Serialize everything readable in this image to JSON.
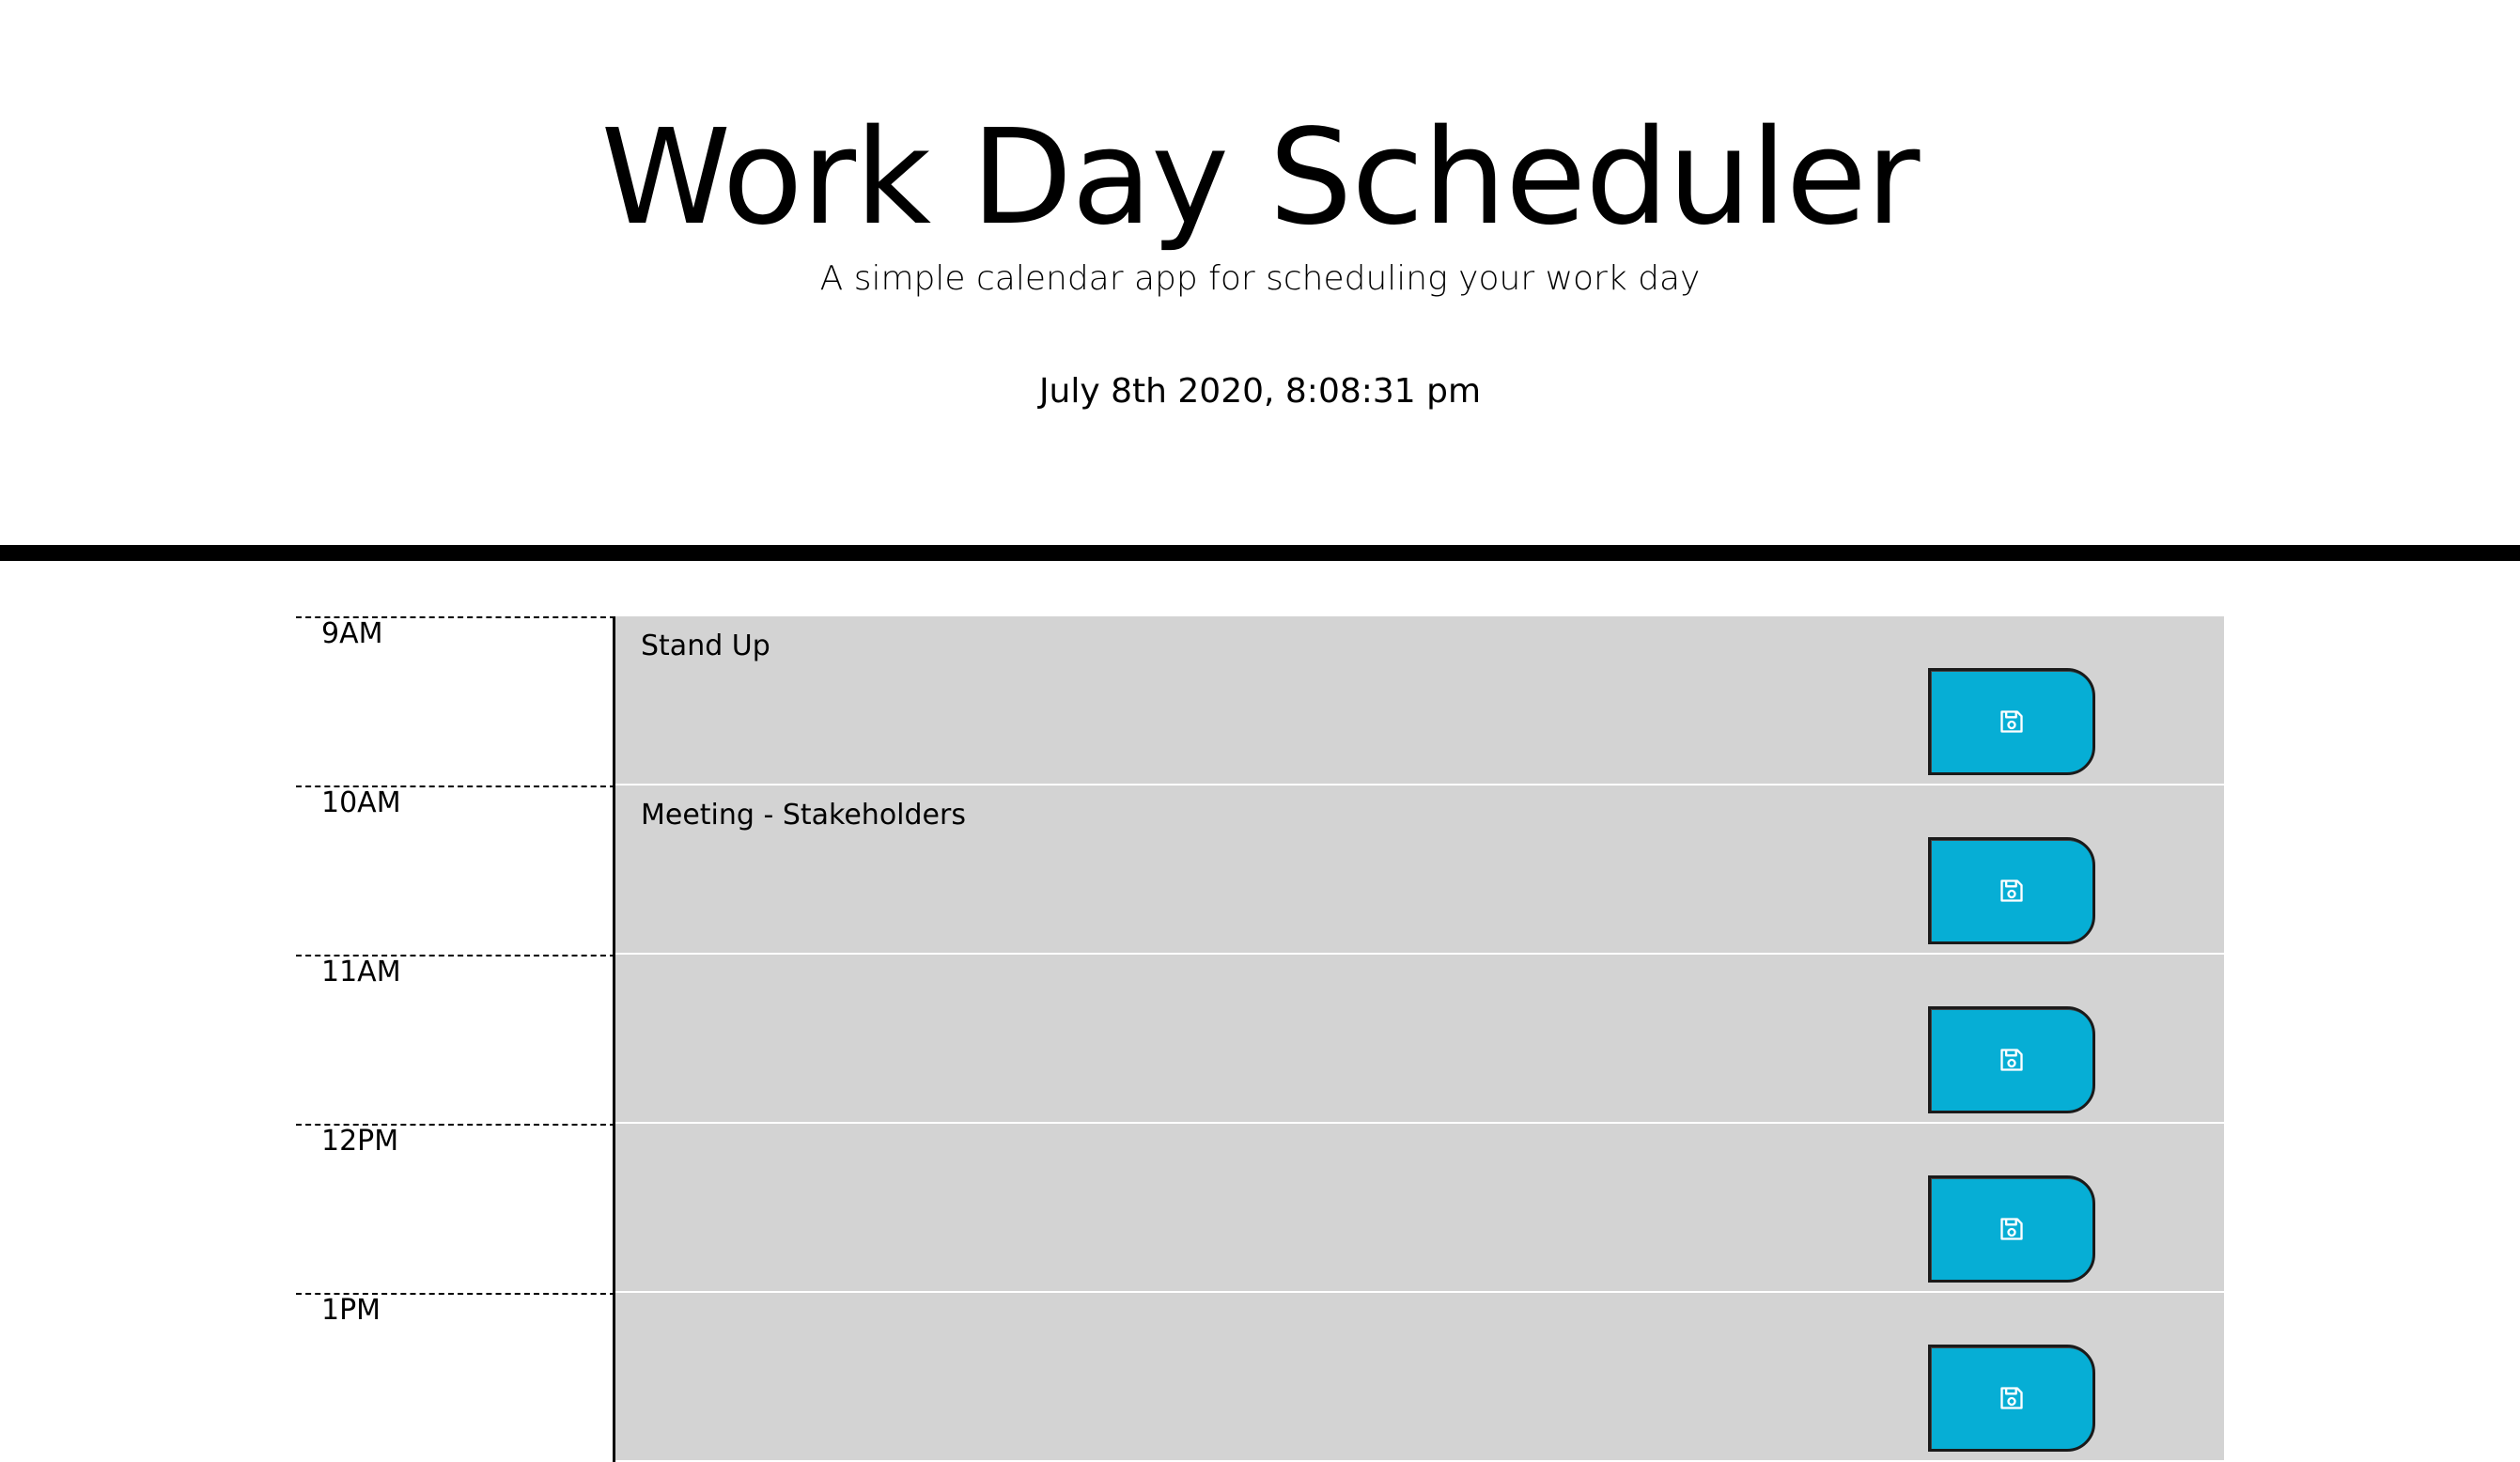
{
  "header": {
    "title": "Work Day Scheduler",
    "subtitle": "A simple calendar app for scheduling your work day",
    "current_datetime": "July 8th 2020, 8:08:31 pm"
  },
  "colors": {
    "save_button": "#06aed5",
    "time_block_past": "#d3d3d3",
    "divider": "#000000"
  },
  "time_blocks": [
    {
      "hour": "9AM",
      "text": "Stand Up",
      "save_icon": "floppy-disk-icon"
    },
    {
      "hour": "10AM",
      "text": "Meeting - Stakeholders",
      "save_icon": "floppy-disk-icon"
    },
    {
      "hour": "11AM",
      "text": "",
      "save_icon": "floppy-disk-icon"
    },
    {
      "hour": "12PM",
      "text": "",
      "save_icon": "floppy-disk-icon"
    },
    {
      "hour": "1PM",
      "text": "",
      "save_icon": "floppy-disk-icon"
    }
  ]
}
